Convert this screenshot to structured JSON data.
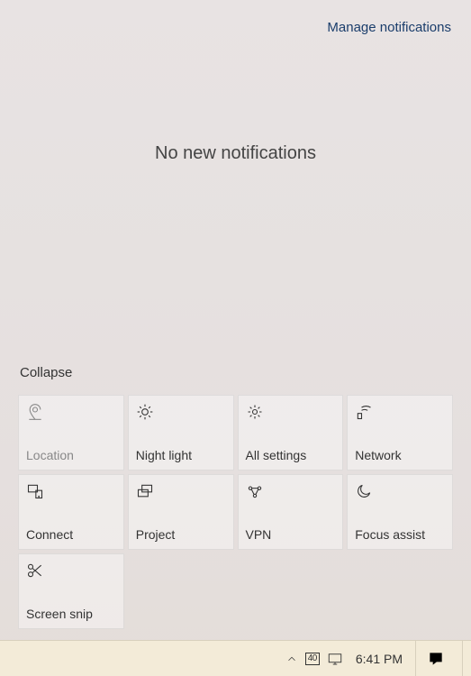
{
  "manage_link": "Manage notifications",
  "empty_message": "No new notifications",
  "collapse_label": "Collapse",
  "tiles": [
    {
      "label": "Location",
      "dim": true
    },
    {
      "label": "Night light"
    },
    {
      "label": "All settings"
    },
    {
      "label": "Network"
    },
    {
      "label": "Connect"
    },
    {
      "label": "Project"
    },
    {
      "label": "VPN"
    },
    {
      "label": "Focus assist"
    },
    {
      "label": "Screen snip"
    }
  ],
  "taskbar": {
    "ime": "40",
    "clock": "6:41 PM"
  }
}
